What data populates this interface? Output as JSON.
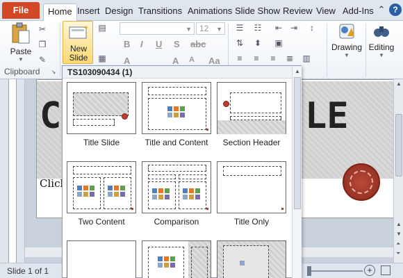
{
  "tabs": {
    "file": "File",
    "home": "Home",
    "insert": "Insert",
    "design": "Design",
    "transitions": "Transitions",
    "animations": "Animations",
    "slideshow": "Slide Show",
    "review": "Review",
    "view": "View",
    "addins": "Add-Ins"
  },
  "ribbon": {
    "paste": "Paste",
    "new_slide_line1": "New",
    "new_slide_line2": "Slide",
    "font_size": "12",
    "font_name": "",
    "clipboard": "Clipboard",
    "drawing": "Drawing",
    "editing": "Editing"
  },
  "slide": {
    "title_left": "Cl",
    "title_right": "LE",
    "subtitle": "Click"
  },
  "gallery": {
    "header": "TS103090434 (1)",
    "layouts": [
      {
        "label": "Title Slide"
      },
      {
        "label": "Title and Content"
      },
      {
        "label": "Section Header"
      },
      {
        "label": "Two Content"
      },
      {
        "label": "Comparison"
      },
      {
        "label": "Title Only"
      }
    ]
  },
  "status": {
    "slide_counter": "Slide 1 of 1"
  },
  "icons": {
    "help": "?",
    "zoom_plus": "+"
  },
  "colors": {
    "file_tab": "#d24726",
    "new_slide_highlight": "#fbd872",
    "seal": "#9c3424"
  }
}
